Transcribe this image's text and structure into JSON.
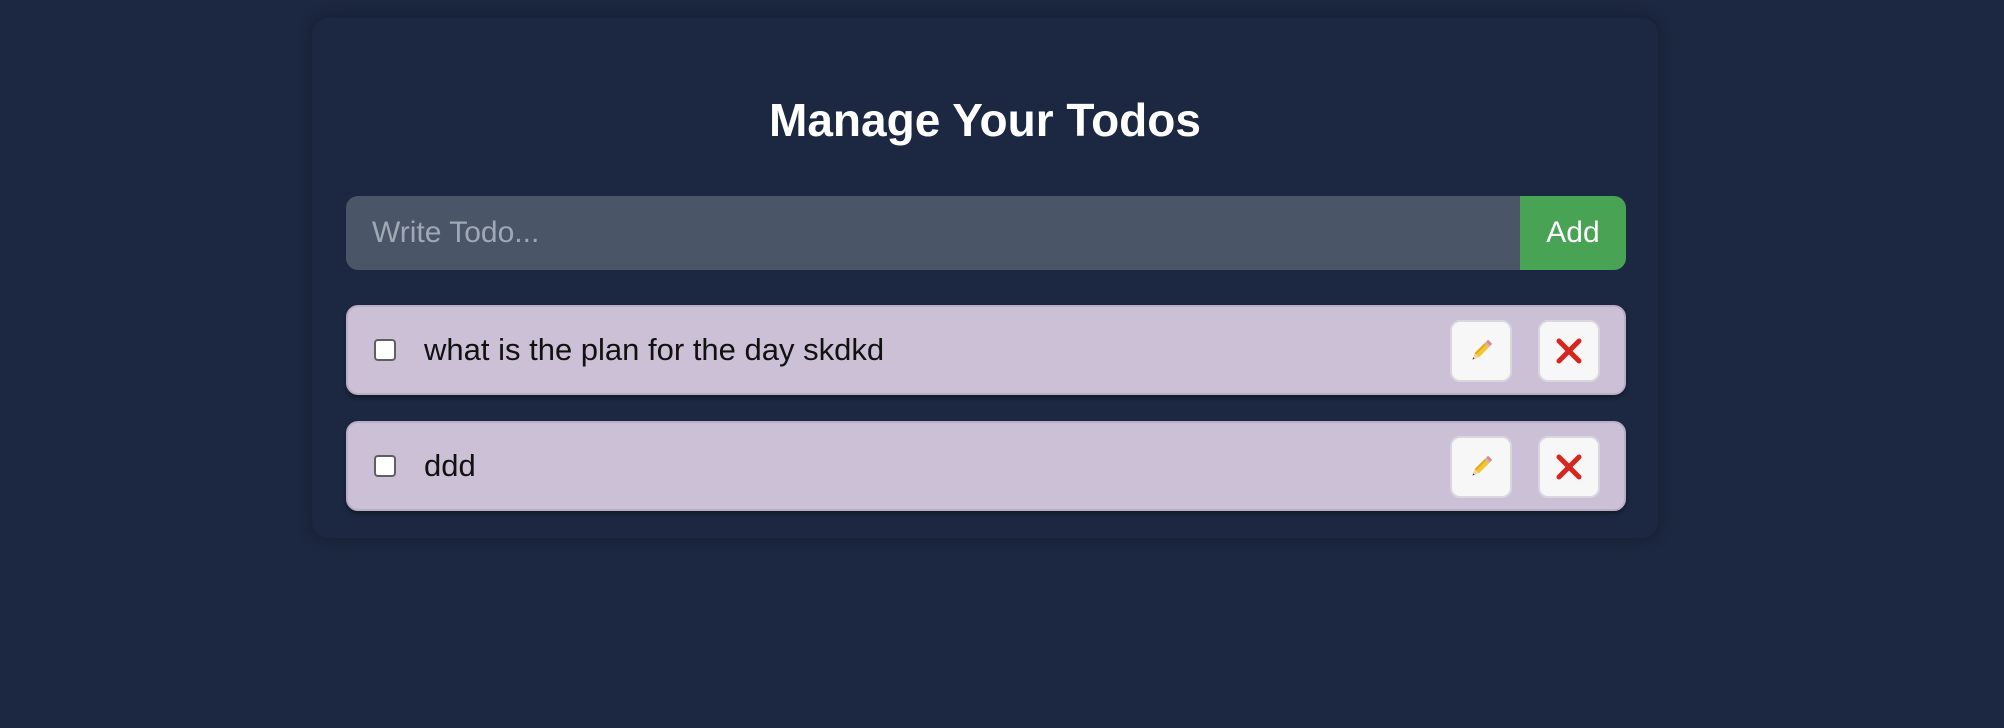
{
  "header": {
    "title": "Manage Your Todos"
  },
  "add_form": {
    "placeholder": "Write Todo...",
    "value": "",
    "add_label": "Add"
  },
  "todos": [
    {
      "text": "what is the plan for the day skdkd",
      "completed": false,
      "edit_icon": "pencil-icon",
      "delete_icon": "close-icon"
    },
    {
      "text": "ddd",
      "completed": false,
      "edit_icon": "pencil-icon",
      "delete_icon": "close-icon"
    }
  ],
  "colors": {
    "background": "#1c2841",
    "input_background": "#4a5568",
    "add_button": "#48a454",
    "todo_item_background": "#ccc0d6",
    "delete_icon": "#d7261e"
  }
}
